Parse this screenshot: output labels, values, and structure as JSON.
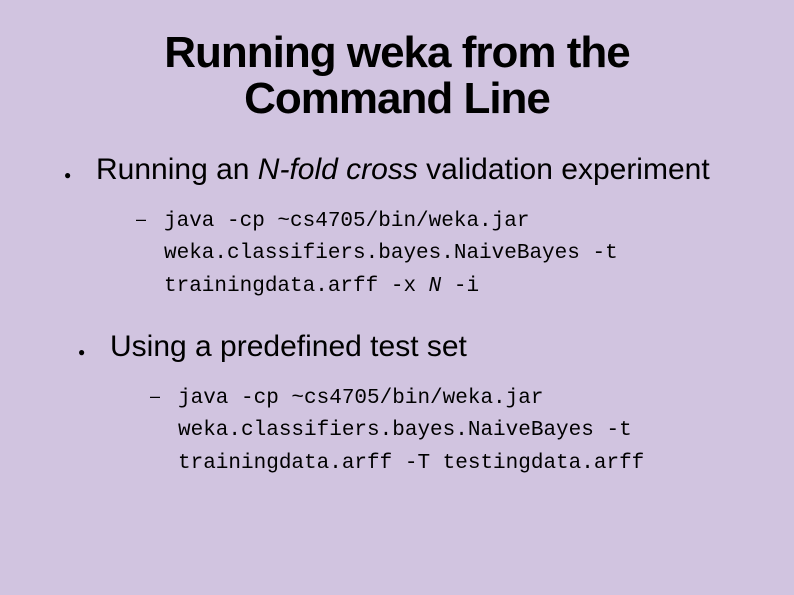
{
  "title_line1": "Running weka from the",
  "title_line2": "Command Line",
  "bullet1_pre": "Running an ",
  "bullet1_italic": "N-fold cross ",
  "bullet1_post": "validation experiment",
  "code1_l1": "java -cp ~cs4705/bin/weka.jar",
  "code1_l2": "weka.classifiers.bayes.NaiveBayes -t",
  "code1_l3a": "trainingdata.arff -x ",
  "code1_l3n": "N",
  "code1_l3b": " -i",
  "bullet2": "Using a predefined test set",
  "code2_l1": "java -cp ~cs4705/bin/weka.jar",
  "code2_l2": "weka.classifiers.bayes.NaiveBayes -t",
  "code2_l3": "trainingdata.arff -T testingdata.arff"
}
